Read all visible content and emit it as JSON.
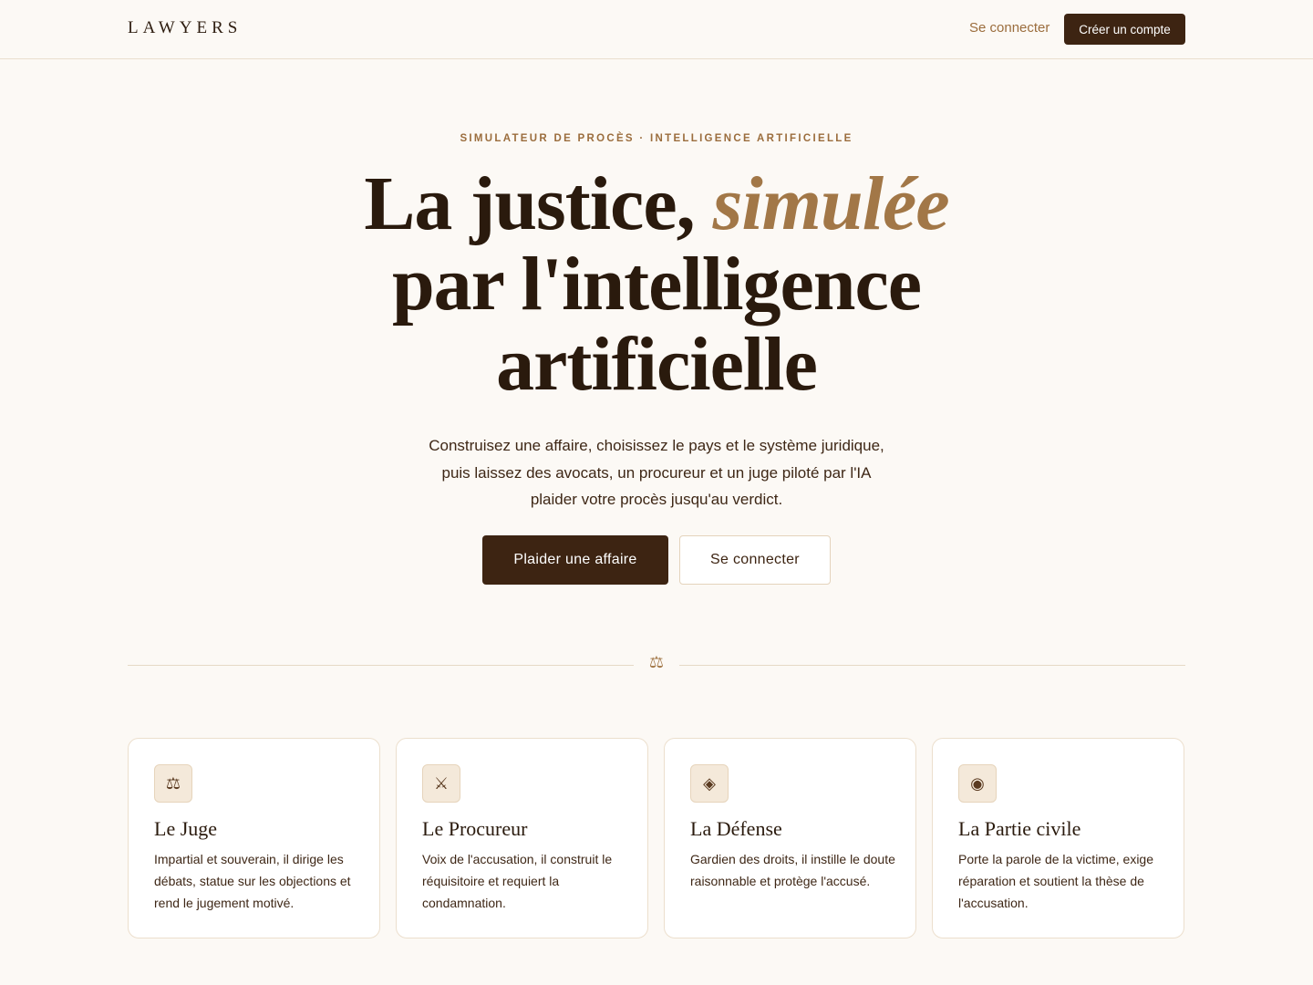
{
  "nav": {
    "logo": "LAWYERS",
    "login_label": "Se connecter",
    "signup_label": "Créer un compte"
  },
  "hero": {
    "eyebrow": "SIMULATEUR DE PROCÈS · INTELLIGENCE ARTIFICIELLE",
    "title_part1": "La justice, ",
    "title_accent": "simulée",
    "title_line2": "par l'intelligence",
    "title_line3": "artificielle",
    "subtitle": "Construisez une affaire, choisissez le pays et le système juridique, puis laissez des avocats, un procureur et un juge piloté par l'IA plaider votre procès jusqu'au verdict.",
    "primary_cta": "Plaider une affaire",
    "secondary_cta": "Se connecter"
  },
  "divider": {
    "icon": "scales-icon",
    "glyph": "⚖"
  },
  "cards": [
    {
      "icon": "scales-icon",
      "glyph": "⚖",
      "title": "Le Juge",
      "description": "Impartial et souverain, il dirige les débats, statue sur les objections et rend le jugement motivé."
    },
    {
      "icon": "crossed-swords-icon",
      "glyph": "⚔",
      "title": "Le Procureur",
      "description": "Voix de l'accusation, il construit le réquisitoire et requiert la condamnation."
    },
    {
      "icon": "diamond-icon",
      "glyph": "◈",
      "title": "La Défense",
      "description": "Gardien des droits, il instille le doute raisonnable et protège l'accusé."
    },
    {
      "icon": "target-circle-icon",
      "glyph": "◉",
      "title": "La Partie civile",
      "description": "Porte la parole de la victime, exige réparation et soutient la thèse de l'accusation."
    }
  ],
  "colors": {
    "background": "#fcf9f5",
    "primary": "#3d2412",
    "accent": "#a27747",
    "text": "#2a1a0d"
  }
}
